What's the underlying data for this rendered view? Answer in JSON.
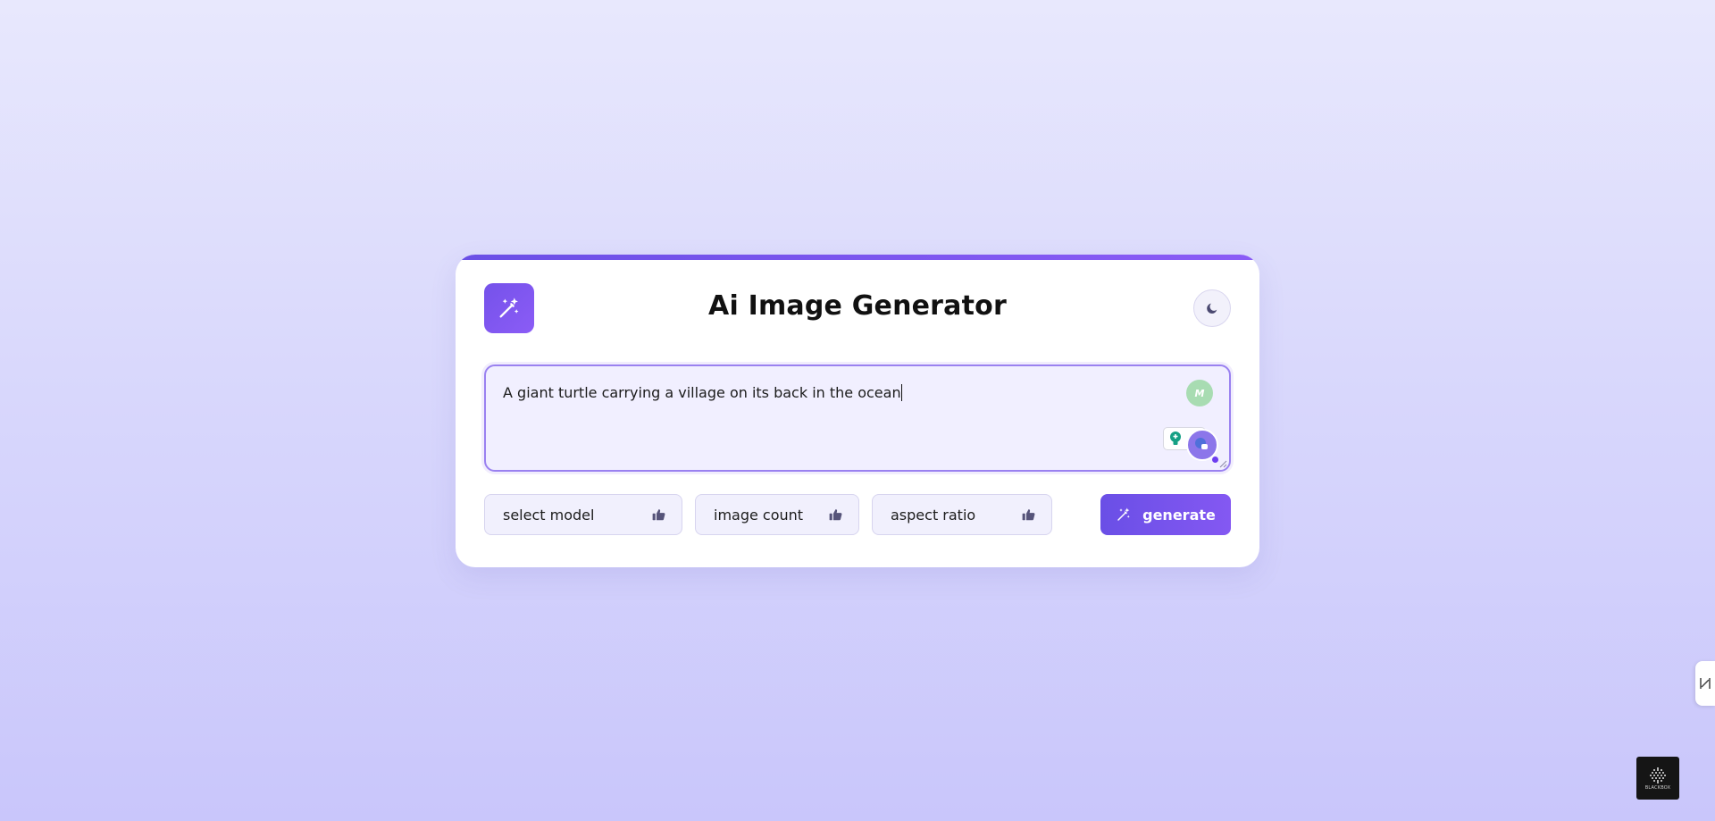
{
  "app": {
    "title": "Ai Image Generator"
  },
  "prompt": {
    "value": "A giant turtle carrying a village on its back in the ocean",
    "extension_badge": "M"
  },
  "controls": {
    "model_select": {
      "selected": "select model",
      "icon": "thumbs-up-icon"
    },
    "count_select": {
      "selected": "image count",
      "icon": "thumbs-up-icon"
    },
    "ratio_select": {
      "selected": "aspect ratio",
      "icon": "thumbs-up-icon"
    },
    "generate_label": "generate"
  },
  "badge": {
    "text": "BLACKBOX"
  },
  "colors": {
    "accent": "#6a4fe6",
    "accent_light": "#8b5cf6",
    "prompt_bg": "#f1efff",
    "select_bg": "#f1f0fd"
  },
  "icons": {
    "logo": "magic-wand-icon",
    "theme_toggle": "moon-icon",
    "generate": "magic-wand-icon"
  }
}
